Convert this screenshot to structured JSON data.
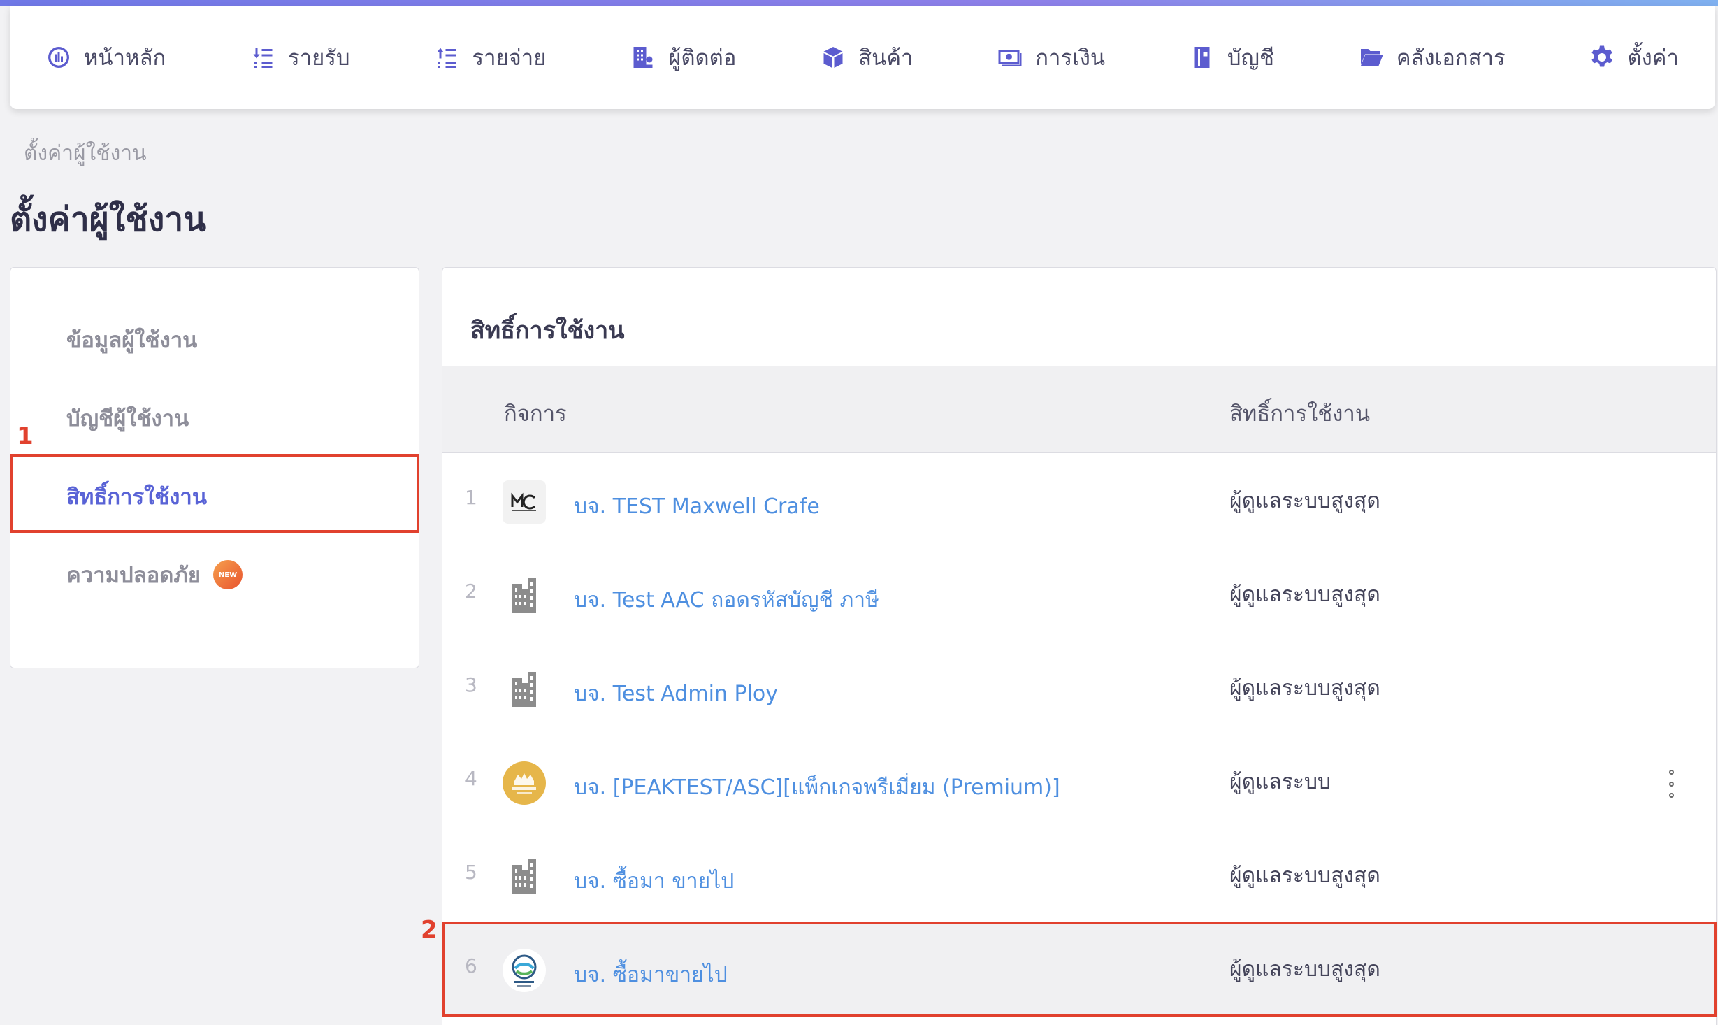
{
  "nav": {
    "items": [
      {
        "label": "หน้าหลัก",
        "icon": "dashboard-icon"
      },
      {
        "label": "รายรับ",
        "icon": "income-icon"
      },
      {
        "label": "รายจ่าย",
        "icon": "expense-icon"
      },
      {
        "label": "ผู้ติดต่อ",
        "icon": "contacts-icon"
      },
      {
        "label": "สินค้า",
        "icon": "box-icon"
      },
      {
        "label": "การเงิน",
        "icon": "money-icon"
      },
      {
        "label": "บัญชี",
        "icon": "ledger-icon"
      },
      {
        "label": "คลังเอกสาร",
        "icon": "folder-icon"
      },
      {
        "label": "ตั้งค่า",
        "icon": "gear-icon"
      }
    ]
  },
  "breadcrumb": "ตั้งค่าผู้ใช้งาน",
  "page_title": "ตั้งค่าผู้ใช้งาน",
  "sidebar": {
    "items": [
      {
        "label": "ข้อมูลผู้ใช้งาน"
      },
      {
        "label": "บัญชีผู้ใช้งาน"
      },
      {
        "label": "สิทธิ์การใช้งาน",
        "active": true
      },
      {
        "label": "ความปลอดภัย",
        "badge": "NEW"
      }
    ]
  },
  "annotations": {
    "first": "1",
    "second": "2"
  },
  "main": {
    "title": "สิทธิ์การใช้งาน",
    "columns": {
      "business": "กิจการ",
      "permission": "สิทธิ์การใช้งาน"
    },
    "rows": [
      {
        "num": "1",
        "name": "บจ. TEST Maxwell Crafe",
        "permission": "ผู้ดูแลระบบสูงสุด",
        "logo": "maxwell-crafe-logo-icon"
      },
      {
        "num": "2",
        "name": "บจ. Test AAC ถอดรหัสบัญชี ภาษี",
        "permission": "ผู้ดูแลระบบสูงสุด",
        "logo": "building-icon"
      },
      {
        "num": "3",
        "name": "บจ. Test Admin Ploy",
        "permission": "ผู้ดูแลระบบสูงสุด",
        "logo": "building-icon"
      },
      {
        "num": "4",
        "name": "บจ. [PEAKTEST/ASC][แพ็กเกจพรีเมี่ยม (Premium)]",
        "permission": "ผู้ดูแลระบบ",
        "logo": "premium-crown-logo-icon"
      },
      {
        "num": "5",
        "name": "บจ. ซื้อมา ขายไป",
        "permission": "ผู้ดูแลระบบสูงสุด",
        "logo": "building-icon"
      },
      {
        "num": "6",
        "name": "บจ. ซื้อมาขายไป",
        "permission": "ผู้ดูแลระบบสูงสุด",
        "logo": "buy-sell-logo-icon"
      }
    ]
  },
  "colors": {
    "accent": "#5963d6",
    "link": "#4e8fe0",
    "highlight": "#e1412e"
  }
}
